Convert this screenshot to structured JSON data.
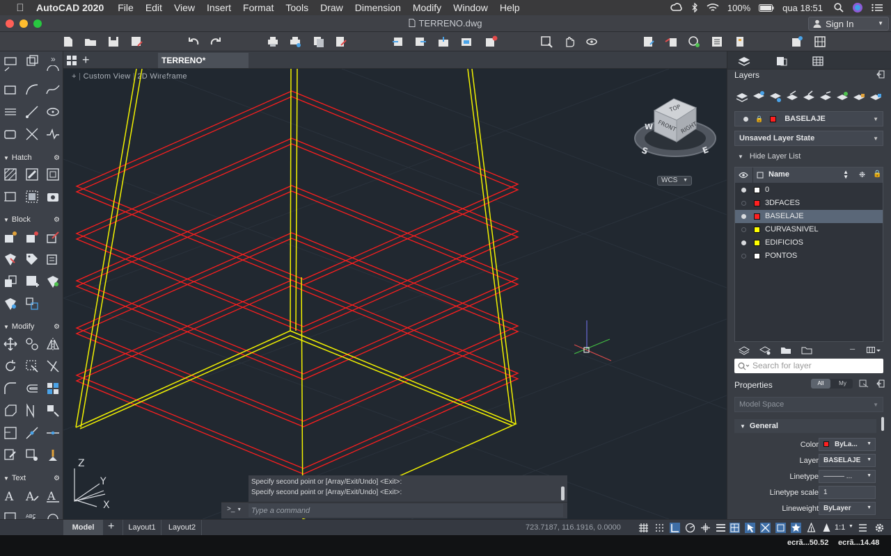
{
  "menubar": {
    "app_name": "AutoCAD 2020",
    "items": [
      "File",
      "Edit",
      "View",
      "Insert",
      "Format",
      "Tools",
      "Draw",
      "Dimension",
      "Modify",
      "Window",
      "Help"
    ],
    "battery": "100%",
    "clock": "qua 18:51"
  },
  "window": {
    "title": "TERRENO.dwg",
    "sign_in": "Sign In"
  },
  "doc_tab": {
    "label": "TERRENO*"
  },
  "viewport": {
    "label_plus": "+",
    "label_view": "Custom View",
    "label_style": "2D Wireframe",
    "viewcube_top": "TOP",
    "viewcube_front": "FRONT",
    "viewcube_right": "RIGHT",
    "compass_w": "W",
    "compass_s": "S",
    "compass_e": "E",
    "wcs": "WCS",
    "ucs_z": "Z",
    "ucs_y": "Y",
    "ucs_x": "X"
  },
  "palette": {
    "sections": [
      "Hatch",
      "Block",
      "Modify",
      "Text"
    ]
  },
  "command": {
    "history_1": "Specify second point or [Array/Exit/Undo] <Exit>:",
    "history_2": "Specify second point or [Array/Exit/Undo] <Exit>:",
    "prompt": ">_",
    "placeholder": "Type a command"
  },
  "layers_panel": {
    "title": "Layers",
    "current_layer": "BASELAJE",
    "layer_state": "Unsaved Layer State",
    "hide_list": "Hide Layer List",
    "name_header": "Name",
    "search_placeholder": "Search for layer",
    "layers": [
      {
        "name": "0",
        "color": "#ffffff",
        "on": true,
        "selected": false
      },
      {
        "name": "3DFACES",
        "color": "#ff2020",
        "on": false,
        "selected": false
      },
      {
        "name": "BASELAJE",
        "color": "#ff2020",
        "on": true,
        "selected": true
      },
      {
        "name": "CURVASNIVEL",
        "color": "#ffff00",
        "on": false,
        "selected": false
      },
      {
        "name": "EDIFICIOS",
        "color": "#ffff00",
        "on": true,
        "selected": false
      },
      {
        "name": "PONTOS",
        "color": "#ffffff",
        "on": false,
        "selected": false
      }
    ]
  },
  "properties_panel": {
    "title": "Properties",
    "filter_all": "All",
    "filter_my": "My",
    "space": "Model Space",
    "section": "General",
    "rows": [
      {
        "label": "Color",
        "value": "ByLa..."
      },
      {
        "label": "Layer",
        "value": "BASELAJE"
      },
      {
        "label": "Linetype",
        "value": "——— ..."
      },
      {
        "label": "Linetype scale",
        "value": "1"
      },
      {
        "label": "Lineweight",
        "value": "ByLayer"
      }
    ]
  },
  "statusbar": {
    "tabs": [
      "Model",
      "Layout1",
      "Layout2"
    ],
    "coords": "723.7187, 116.1916, 0.0000",
    "scale": "1:1"
  },
  "dock": {
    "thumb_1": "ecrã...50.52",
    "thumb_2": "ecrã...14.48"
  },
  "colors": {
    "accent_red": "#ff2020",
    "accent_yellow": "#f2f200",
    "viewport_bg": "#212830"
  }
}
